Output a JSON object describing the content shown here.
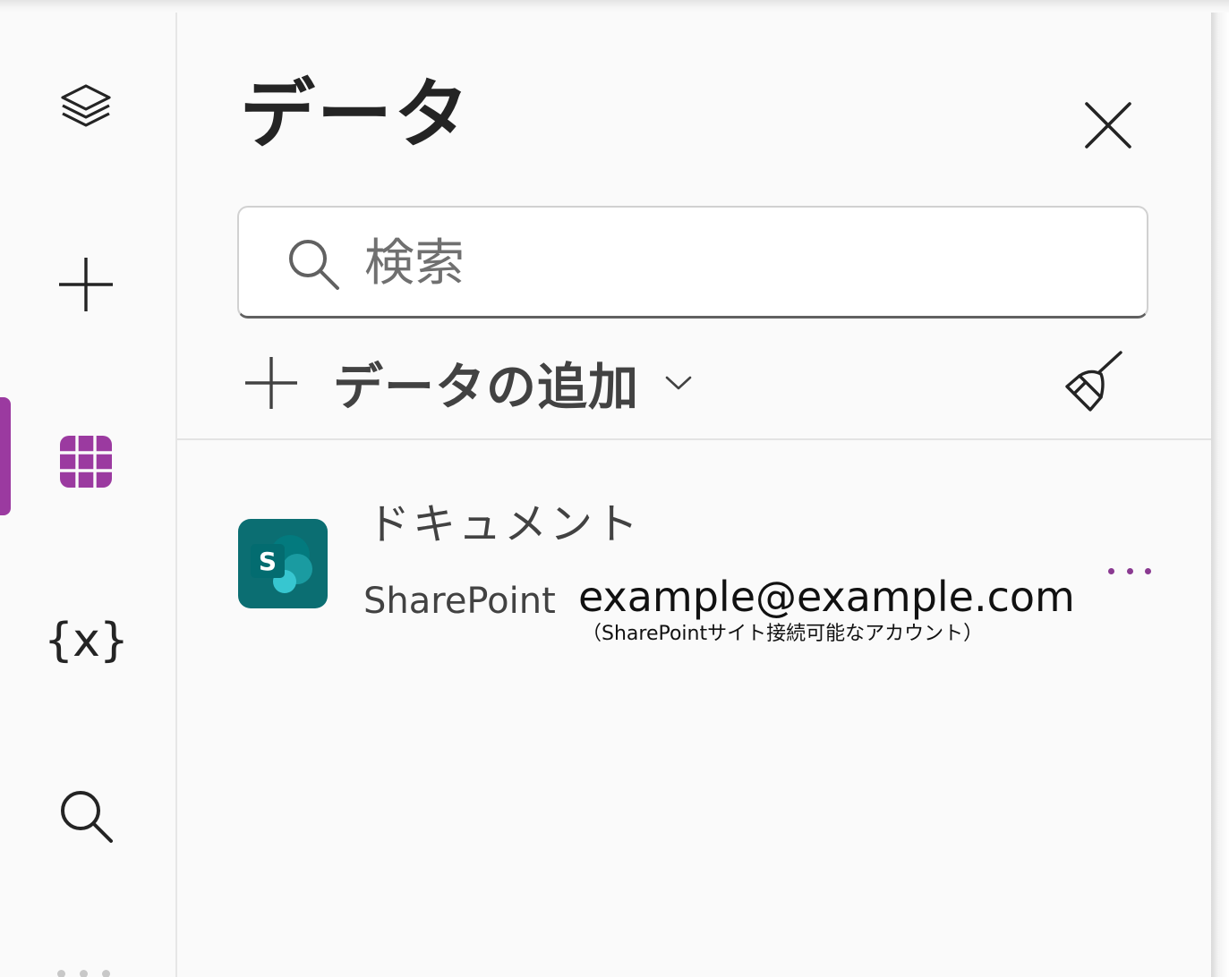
{
  "panel": {
    "title": "データ",
    "search": {
      "value": "",
      "placeholder": "検索"
    },
    "add_data_label": "データの追加"
  },
  "items": [
    {
      "title": "ドキュメント",
      "source": "SharePoint",
      "account": "example@example.com",
      "note": "（SharePointサイト接続可能なアカウント）",
      "logo_letter": "S"
    }
  ],
  "theme": {
    "accent": "#9b3aa0",
    "sharepoint_dark": "#036c70",
    "sharepoint_mid": "#1a9ba1",
    "sharepoint_light": "#37c6d0"
  },
  "rail": {
    "items": [
      {
        "icon": "layers-icon"
      },
      {
        "icon": "plus-icon"
      },
      {
        "icon": "data-table-icon",
        "active": true
      },
      {
        "icon": "variables-icon",
        "symbol": "{x}"
      },
      {
        "icon": "search-icon"
      }
    ]
  }
}
